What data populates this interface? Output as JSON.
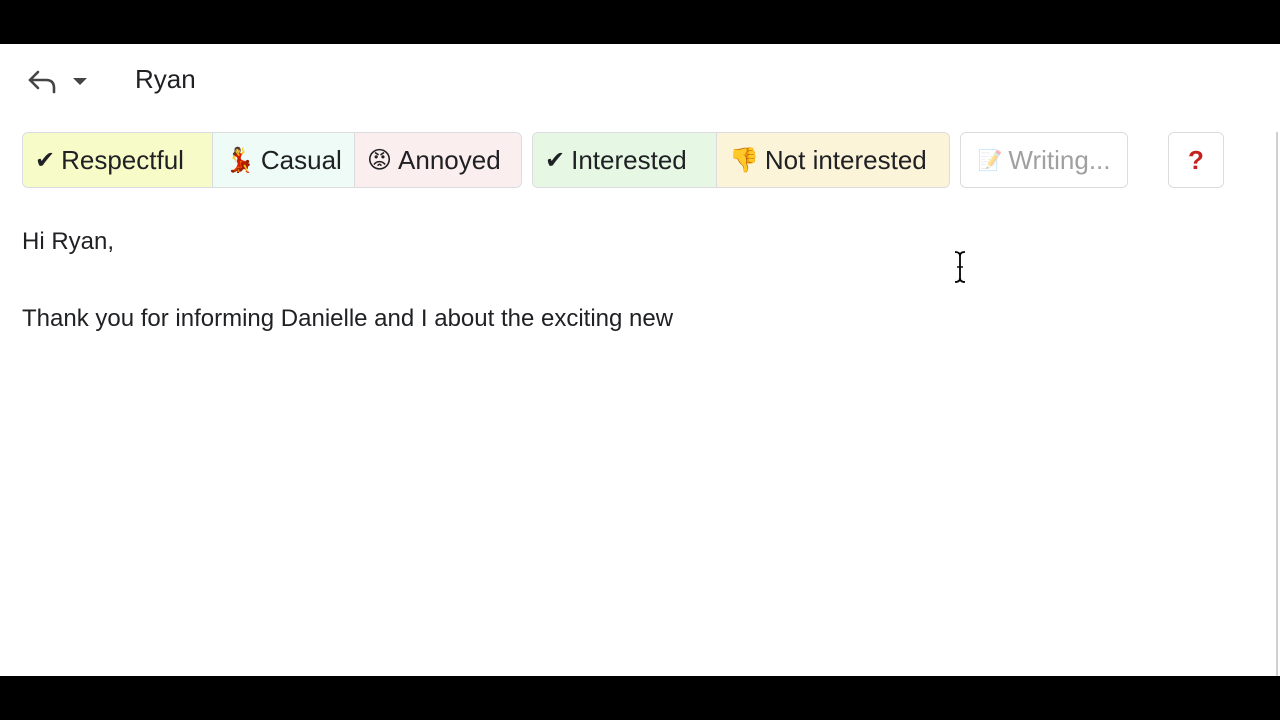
{
  "header": {
    "recipient": "Ryan",
    "reply_icon": "reply-icon",
    "dropdown_icon": "chevron-down-icon"
  },
  "tone_chips": [
    {
      "emoji": "✔",
      "label": "Respectful",
      "color": "#f7fbc8"
    },
    {
      "emoji": "💃",
      "label": "Casual",
      "color": "#eefbf6"
    },
    {
      "emoji": "😡",
      "label": "Annoyed",
      "color": "#fbeeee"
    }
  ],
  "interest_chips": [
    {
      "emoji": "✔",
      "label": "Interested",
      "color": "#e6f8e4"
    },
    {
      "emoji": "👎",
      "label": "Not interested",
      "color": "#fbf4d8"
    }
  ],
  "writing_button": {
    "emoji": "📝",
    "label": "Writing..."
  },
  "help_button": {
    "label": "?",
    "color": "#c5221f"
  },
  "email_body": {
    "greeting": "Hi Ryan,",
    "paragraph_1": "Thank you for informing Danielle and I about the exciting new"
  }
}
